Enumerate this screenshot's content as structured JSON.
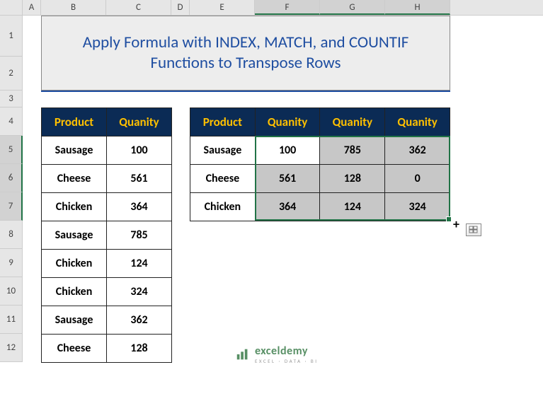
{
  "columns": [
    "A",
    "B",
    "C",
    "D",
    "E",
    "F",
    "G",
    "H"
  ],
  "rows": [
    "1",
    "2",
    "3",
    "4",
    "5",
    "6",
    "7",
    "8",
    "9",
    "10",
    "11",
    "12"
  ],
  "selected_cols": [
    "F",
    "G",
    "H"
  ],
  "selected_rows": [
    "5",
    "6",
    "7"
  ],
  "title": "Apply Formula with INDEX, MATCH, and COUNTIF Functions to Transpose Rows",
  "table1": {
    "headers": [
      "Product",
      "Quanity"
    ],
    "rows": [
      [
        "Sausage",
        "100"
      ],
      [
        "Cheese",
        "561"
      ],
      [
        "Chicken",
        "364"
      ],
      [
        "Sausage",
        "785"
      ],
      [
        "Chicken",
        "124"
      ],
      [
        "Chicken",
        "324"
      ],
      [
        "Sausage",
        "362"
      ],
      [
        "Cheese",
        "128"
      ]
    ]
  },
  "table2": {
    "headers": [
      "Product",
      "Quanity",
      "Quanity",
      "Quanity"
    ],
    "rows": [
      [
        "Sausage",
        "100",
        "785",
        "362"
      ],
      [
        "Cheese",
        "561",
        "128",
        "0"
      ],
      [
        "Chicken",
        "364",
        "124",
        "324"
      ]
    ]
  },
  "watermark": {
    "brand": "exceldemy",
    "tag": "EXCEL · DATA · BI"
  },
  "autofill_tooltip": "Auto Fill Options"
}
